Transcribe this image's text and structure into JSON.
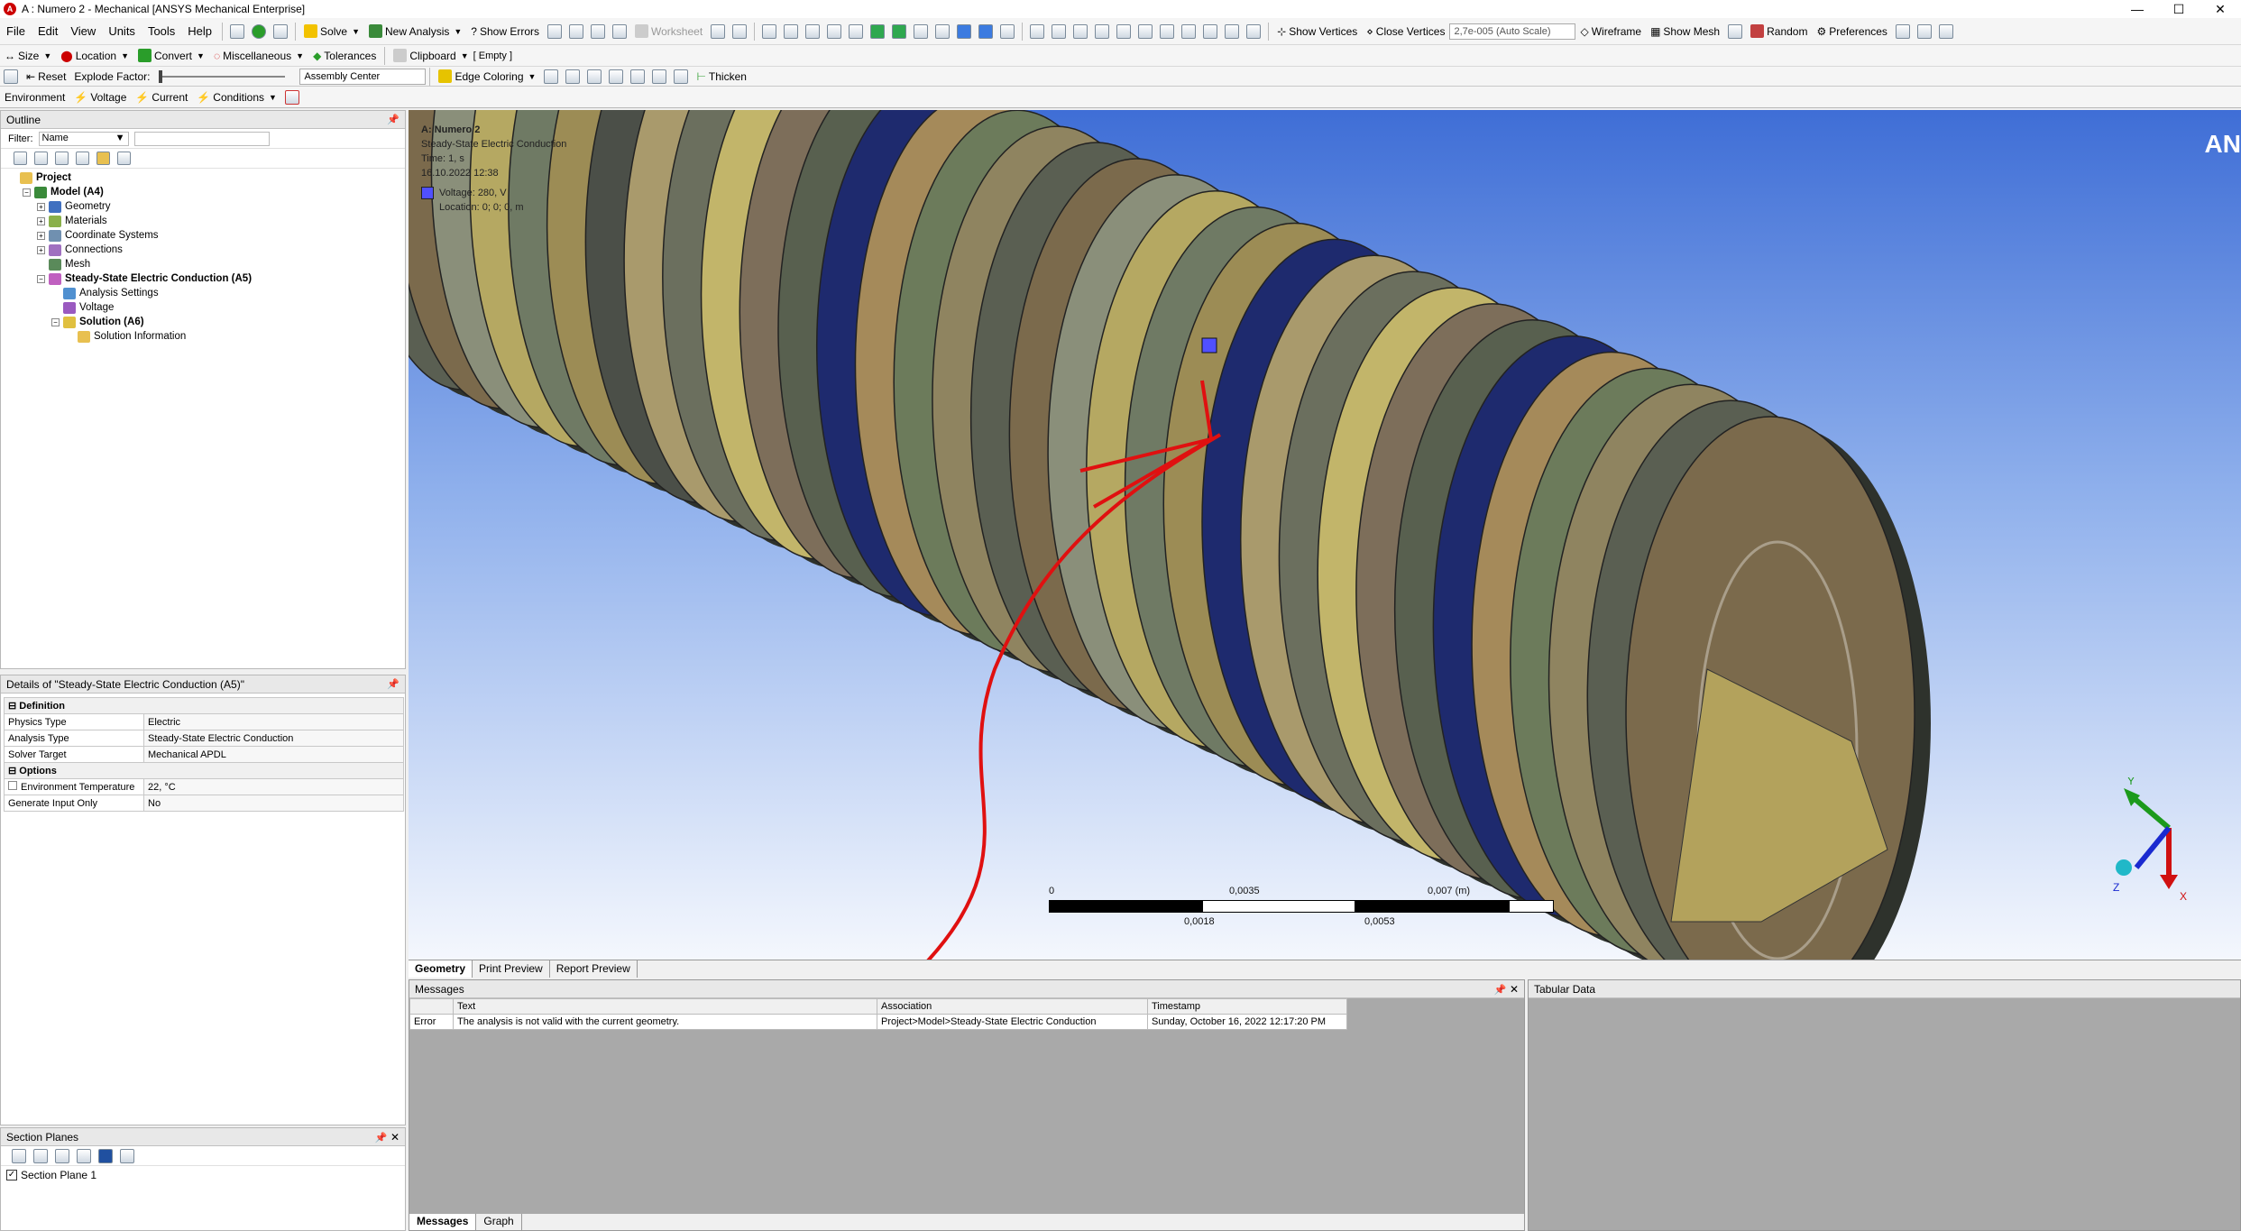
{
  "titlebar": {
    "title": "A : Numero 2 - Mechanical [ANSYS Mechanical Enterprise]",
    "logo": "A"
  },
  "menu": [
    "File",
    "Edit",
    "View",
    "Units",
    "Tools",
    "Help"
  ],
  "toolbar1": {
    "solve": "Solve",
    "new_analysis": "New Analysis",
    "show_errors": "Show Errors",
    "worksheet": "Worksheet",
    "show_vertices": "Show Vertices",
    "close_vertices": "Close Vertices",
    "scale_value": "2,7e-005 (Auto Scale)",
    "wireframe": "Wireframe",
    "show_mesh": "Show Mesh",
    "random": "Random",
    "preferences": "Preferences"
  },
  "toolbar2": {
    "size": "Size",
    "location": "Location",
    "convert": "Convert",
    "miscellaneous": "Miscellaneous",
    "tolerances": "Tolerances",
    "clipboard": "Clipboard",
    "clipboard_value": "[ Empty ]"
  },
  "toolbar3": {
    "reset": "Reset",
    "explode_factor": "Explode Factor:",
    "assembly_center": "Assembly Center",
    "edge_coloring": "Edge Coloring",
    "thicken": "Thicken"
  },
  "toolbar4": {
    "environment": "Environment",
    "voltage": "Voltage",
    "current": "Current",
    "conditions": "Conditions"
  },
  "outline": {
    "title": "Outline",
    "filter_label": "Filter:",
    "filter_value": "Name",
    "tree": [
      {
        "label": "Project",
        "depth": 0,
        "bold": true,
        "exp": ""
      },
      {
        "label": "Model (A4)",
        "depth": 1,
        "bold": true,
        "exp": "−"
      },
      {
        "label": "Geometry",
        "depth": 2,
        "bold": false,
        "exp": "+"
      },
      {
        "label": "Materials",
        "depth": 2,
        "bold": false,
        "exp": "+"
      },
      {
        "label": "Coordinate Systems",
        "depth": 2,
        "bold": false,
        "exp": "+"
      },
      {
        "label": "Connections",
        "depth": 2,
        "bold": false,
        "exp": "+"
      },
      {
        "label": "Mesh",
        "depth": 2,
        "bold": false,
        "exp": ""
      },
      {
        "label": "Steady-State Electric Conduction (A5)",
        "depth": 2,
        "bold": true,
        "exp": "−"
      },
      {
        "label": "Analysis Settings",
        "depth": 3,
        "bold": false,
        "exp": ""
      },
      {
        "label": "Voltage",
        "depth": 3,
        "bold": false,
        "exp": ""
      },
      {
        "label": "Solution (A6)",
        "depth": 3,
        "bold": true,
        "exp": "−"
      },
      {
        "label": "Solution Information",
        "depth": 4,
        "bold": false,
        "exp": ""
      }
    ]
  },
  "details": {
    "title": "Details of \"Steady-State Electric Conduction (A5)\"",
    "groups": [
      {
        "name": "Definition",
        "rows": [
          [
            "Physics Type",
            "Electric"
          ],
          [
            "Analysis Type",
            "Steady-State Electric Conduction"
          ],
          [
            "Solver Target",
            "Mechanical APDL"
          ]
        ]
      },
      {
        "name": "Options",
        "rows": [
          [
            "Environment Temperature",
            "22, °C"
          ],
          [
            "Generate Input Only",
            "No"
          ]
        ]
      }
    ]
  },
  "section_planes": {
    "title": "Section Planes",
    "items": [
      "Section Plane 1"
    ]
  },
  "viewport": {
    "legend_title": "A: Numero 2",
    "legend_sub": "Steady-State Electric Conduction",
    "legend_time": "Time: 1, s",
    "legend_date": "16.10.2022 12:38",
    "legend_item": "Voltage: 280, V",
    "legend_loc": "Location: 0; 0; 0, m",
    "logo": "AN",
    "scale": [
      "0",
      "0,0018",
      "0,0035",
      "0,0053",
      "0,007 (m)"
    ],
    "tabs": [
      "Geometry",
      "Print Preview",
      "Report Preview"
    ],
    "axes": {
      "x": "X",
      "y": "Y",
      "z": "Z"
    },
    "colors": {
      "accent": "#1f5fd1",
      "annotation": "#e01010"
    }
  },
  "messages": {
    "title": "Messages",
    "columns": [
      "",
      "Text",
      "Association",
      "Timestamp"
    ],
    "rows": [
      [
        "Error",
        "The analysis is not valid with the current geometry.",
        "Project>Model>Steady-State Electric Conduction",
        "Sunday, October 16, 2022 12:17:20 PM"
      ]
    ],
    "tabs": [
      "Messages",
      "Graph"
    ]
  },
  "tabular": {
    "title": "Tabular Data"
  }
}
